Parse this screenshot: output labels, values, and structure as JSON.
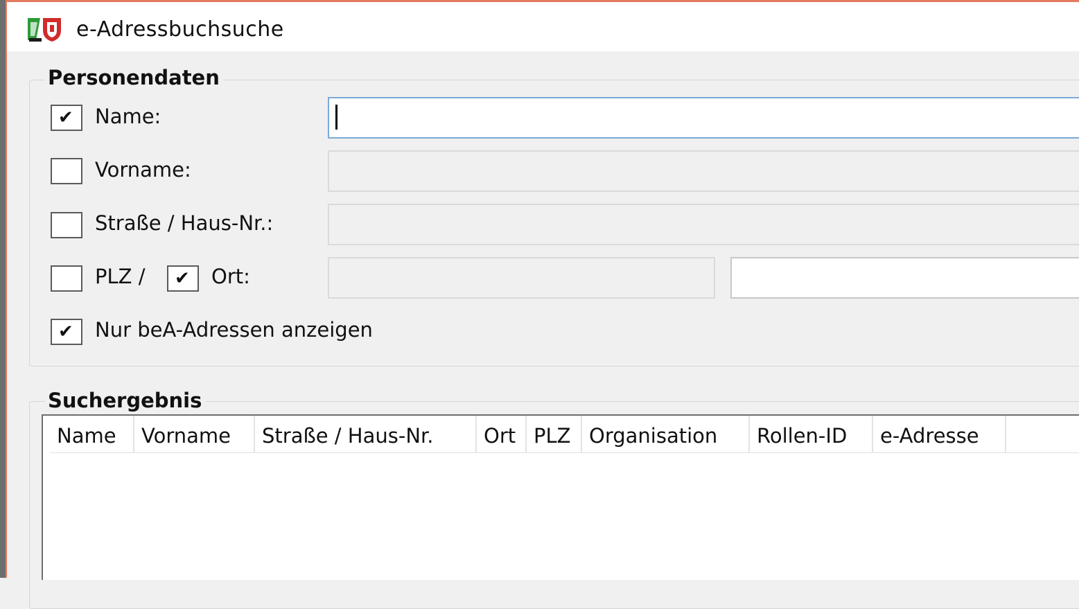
{
  "window": {
    "title": "e-Adressbuchsuche",
    "icon": "nrw-coat-of-arms-icon"
  },
  "personendaten": {
    "legend": "Personendaten",
    "name": {
      "label": "Name:",
      "checked": true,
      "value": ""
    },
    "vorname": {
      "label": "Vorname:",
      "checked": false,
      "value": ""
    },
    "strasse": {
      "label": "Straße / Haus-Nr.:",
      "checked": false,
      "value": ""
    },
    "plz": {
      "label": "PLZ /",
      "checked": false,
      "value": ""
    },
    "ort": {
      "label": "Ort:",
      "checked": true,
      "value": ""
    },
    "nur_bea": {
      "label": "Nur beA-Adressen anzeigen",
      "checked": true
    }
  },
  "suchergebnis": {
    "legend": "Suchergebnis",
    "columns": [
      "Name",
      "Vorname",
      "Straße / Haus-Nr.",
      "Ort",
      "PLZ",
      "Organisation",
      "Rollen-ID",
      "e-Adresse"
    ],
    "rows": []
  },
  "colors": {
    "window_border": "#e27b60",
    "active_field_border": "#7aa9d9",
    "background": "#f0f0f0"
  }
}
